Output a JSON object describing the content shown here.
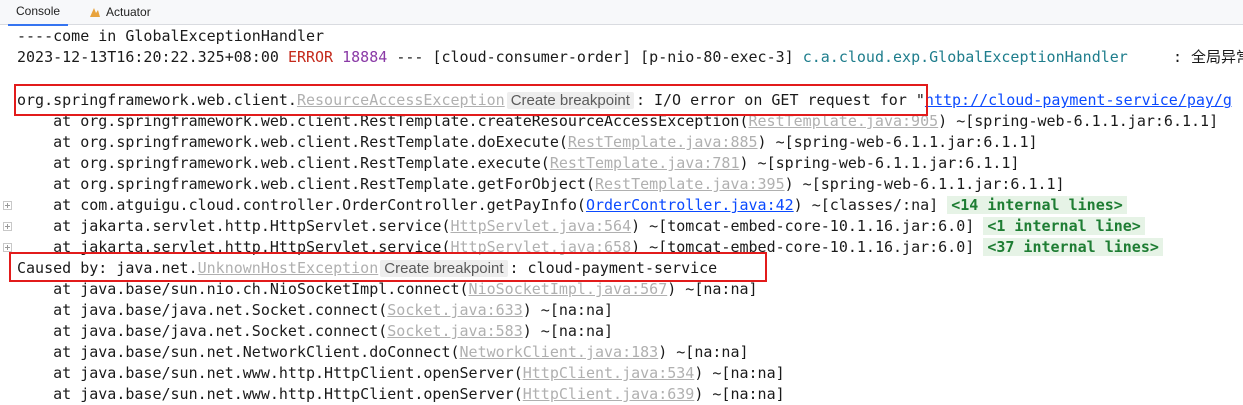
{
  "tabs": [
    {
      "label": "Console",
      "active": true
    },
    {
      "label": "Actuator",
      "active": false,
      "icon": "actuator-icon"
    }
  ],
  "console": {
    "line1": "----come in GlobalExceptionHandler",
    "line2": {
      "timestamp": "2023-12-13T16:20:22.325+08:00",
      "level": "ERROR",
      "pid": "18884",
      "sep": "---",
      "app": "[cloud-consumer-order]",
      "thread": "[p-nio-80-exec-3]",
      "logger": "c.a.cloud.exp.GlobalExceptionHandler",
      "message": ": 全局异常"
    },
    "exception": {
      "prefix": "org.springframework.web.client.",
      "class_link": "ResourceAccessException",
      "breakpoint": "Create breakpoint",
      "message": ": I/O error on GET request for \"",
      "url": "http://cloud-payment-service/pay/g"
    },
    "stack1": [
      {
        "prefix": "    at org.springframework.web.client.RestTemplate.createResourceAccessException(",
        "link": "RestTemplate.java:905",
        "suffix": ") ~[spring-web-6.1.1.jar:6.1.1]",
        "fold": false
      },
      {
        "prefix": "    at org.springframework.web.client.RestTemplate.doExecute(",
        "link": "RestTemplate.java:885",
        "suffix": ") ~[spring-web-6.1.1.jar:6.1.1]",
        "fold": false
      },
      {
        "prefix": "    at org.springframework.web.client.RestTemplate.execute(",
        "link": "RestTemplate.java:781",
        "suffix": ") ~[spring-web-6.1.1.jar:6.1.1]",
        "fold": false
      },
      {
        "prefix": "    at org.springframework.web.client.RestTemplate.getForObject(",
        "link": "RestTemplate.java:395",
        "suffix": ") ~[spring-web-6.1.1.jar:6.1.1]",
        "fold": false
      },
      {
        "prefix": "    at com.atguigu.cloud.controller.OrderController.getPayInfo(",
        "link": "OrderController.java:42",
        "link_blue": true,
        "suffix": ") ~[classes/:na] ",
        "internal": "<14 internal lines>",
        "fold": true
      },
      {
        "prefix": "    at jakarta.servlet.http.HttpServlet.service(",
        "link": "HttpServlet.java:564",
        "suffix": ") ~[tomcat-embed-core-10.1.16.jar:6.0] ",
        "internal": "<1 internal line>",
        "fold": true
      },
      {
        "prefix": "    at jakarta.servlet.http.HttpServlet.service(",
        "link": "HttpServlet.java:658",
        "suffix": ") ~[tomcat-embed-core-10.1.16.jar:6.0] ",
        "internal": "<37 internal lines>",
        "fold": true
      }
    ],
    "caused_by": {
      "prefix": "Caused by: java.net.",
      "class_link": "UnknownHostException",
      "breakpoint": "Create breakpoint",
      "message": ": cloud-payment-service"
    },
    "stack2": [
      {
        "prefix": "    at java.base/sun.nio.ch.NioSocketImpl.connect(",
        "link": "NioSocketImpl.java:567",
        "suffix": ") ~[na:na]"
      },
      {
        "prefix": "    at java.base/java.net.Socket.connect(",
        "link": "Socket.java:633",
        "suffix": ") ~[na:na]"
      },
      {
        "prefix": "    at java.base/java.net.Socket.connect(",
        "link": "Socket.java:583",
        "suffix": ") ~[na:na]"
      },
      {
        "prefix": "    at java.base/sun.net.NetworkClient.doConnect(",
        "link": "NetworkClient.java:183",
        "suffix": ") ~[na:na]"
      },
      {
        "prefix": "    at java.base/sun.net.www.http.HttpClient.openServer(",
        "link": "HttpClient.java:534",
        "suffix": ") ~[na:na]"
      },
      {
        "prefix": "    at java.base/sun.net.www.http.HttpClient.openServer(",
        "link": "HttpClient.java:639",
        "suffix": ") ~[na:na]"
      }
    ]
  },
  "colors": {
    "error": "#c4291b",
    "highlight_box": "#e21b1b",
    "link": "#0b4aff",
    "internal_lines": "#1e7d33"
  }
}
